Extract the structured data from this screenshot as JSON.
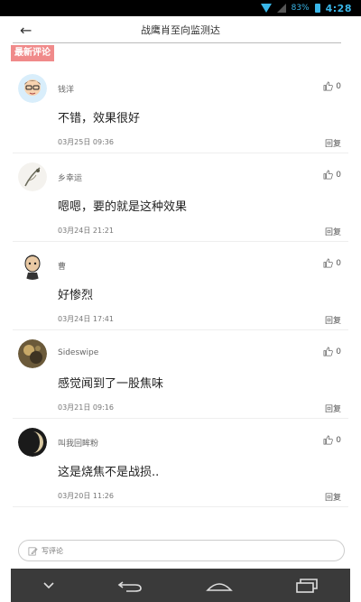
{
  "status_bar": {
    "battery": "83%",
    "time": "4:28"
  },
  "header": {
    "back_icon": "back-arrow-icon",
    "title": "战鹰肖至向监测达"
  },
  "section_tag": "最新评论",
  "comments": [
    {
      "name": "钱洋",
      "content": "不错，效果很好",
      "time": "03月25日 09:36",
      "likes": "0",
      "reply": "回复"
    },
    {
      "name": "乡幸运",
      "content": "嗯嗯，要的就是这种效果",
      "time": "03月24日 21:21",
      "likes": "0",
      "reply": "回复"
    },
    {
      "name": "曹",
      "content": "好惨烈",
      "time": "03月24日 17:41",
      "likes": "0",
      "reply": "回复"
    },
    {
      "name": "Sideswipe",
      "content": "感觉闻到了一股焦味",
      "time": "03月21日 09:16",
      "likes": "0",
      "reply": "回复"
    },
    {
      "name": "叫我回眸粉",
      "content": "这是烧焦不是战损..",
      "time": "03月20日 11:26",
      "likes": "0",
      "reply": "回复"
    }
  ],
  "input": {
    "placeholder": "写评论"
  },
  "nav": [
    "collapse-icon",
    "back-icon",
    "home-icon",
    "recents-icon"
  ]
}
